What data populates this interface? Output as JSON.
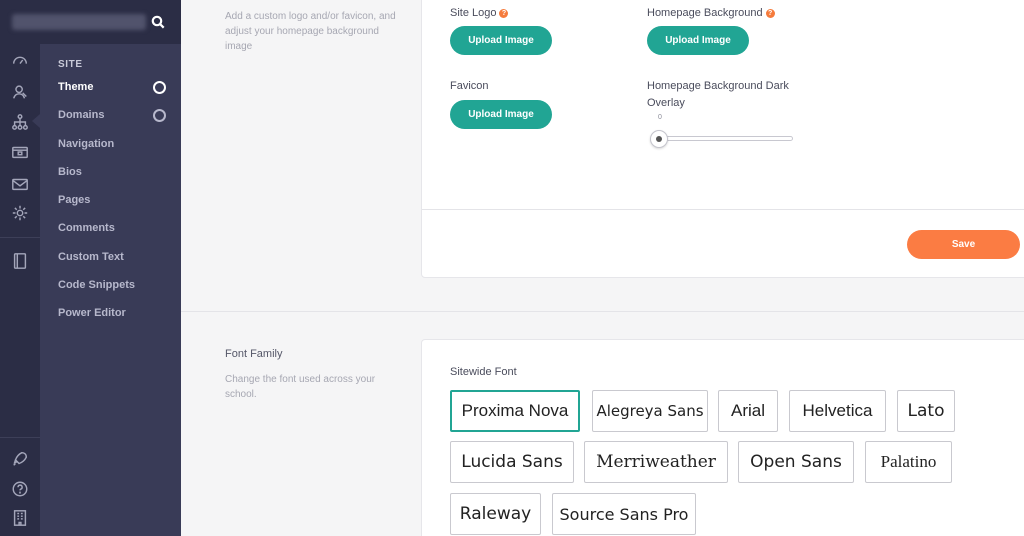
{
  "sidebar": {
    "section_label": "SITE",
    "items": [
      {
        "label": "Theme"
      },
      {
        "label": "Domains"
      },
      {
        "label": "Navigation"
      },
      {
        "label": "Bios"
      },
      {
        "label": "Pages"
      },
      {
        "label": "Comments"
      },
      {
        "label": "Custom Text"
      },
      {
        "label": "Code Snippets"
      },
      {
        "label": "Power Editor"
      }
    ]
  },
  "branding": {
    "description": "Add a custom logo and/or favicon, and adjust your homepage background image",
    "site_logo_label": "Site Logo",
    "homepage_background_label": "Homepage Background",
    "favicon_label": "Favicon",
    "overlay_label": "Homepage Background Dark Overlay",
    "upload_label": "Upload Image",
    "overlay_value": "0",
    "save_label": "Save"
  },
  "font_family": {
    "title": "Font Family",
    "description": "Change the font used across your school.",
    "field_label": "Sitewide Font",
    "selected": "Proxima Nova",
    "fonts": [
      "Proxima Nova",
      "Alegreya Sans",
      "Arial",
      "Helvetica",
      "Lato",
      "Lucida Sans",
      "Merriweather",
      "Open Sans",
      "Palatino",
      "Raleway",
      "Source Sans Pro"
    ]
  },
  "colors": {
    "accent": "#21a594",
    "save": "#fb7c43",
    "sidebar": "#393b57",
    "rail": "#2b2d45"
  }
}
